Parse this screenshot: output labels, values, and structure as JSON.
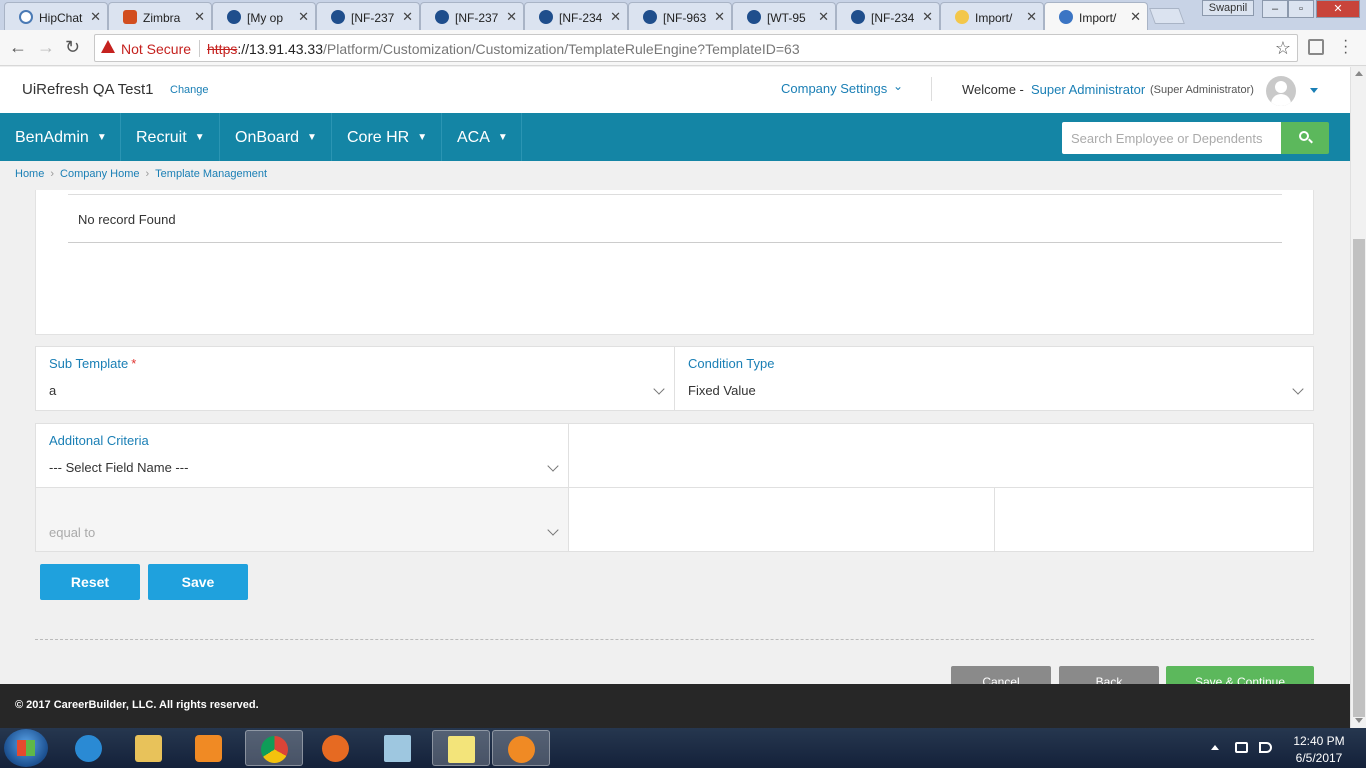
{
  "browser": {
    "tabs": [
      {
        "title": "HipChat",
        "icon": "hipchat-icon"
      },
      {
        "title": "Zimbra",
        "icon": "zimbra-icon"
      },
      {
        "title": "[My op",
        "icon": "jira-icon"
      },
      {
        "title": "[NF-237",
        "icon": "jira-icon"
      },
      {
        "title": "[NF-237",
        "icon": "jira-icon"
      },
      {
        "title": "[NF-234",
        "icon": "jira-icon"
      },
      {
        "title": "[NF-963",
        "icon": "jira-icon"
      },
      {
        "title": "[WT-95",
        "icon": "jira-icon"
      },
      {
        "title": "[NF-234",
        "icon": "jira-icon"
      },
      {
        "title": "Import/",
        "icon": "import-icon"
      },
      {
        "title": "Import/",
        "icon": "import-icon"
      }
    ],
    "window_user": "Swapnil",
    "not_secure": "Not Secure",
    "url_scheme": "https",
    "url_host": "://13.91.43.33",
    "url_path": "/Platform/Customization/Customization/TemplateRuleEngine?TemplateID=63"
  },
  "header": {
    "company_name": "UiRefresh QA Test1",
    "change_link": "Change",
    "company_settings": "Company Settings",
    "welcome": "Welcome -",
    "user_name": "Super Administrator",
    "user_role": "(Super Administrator)"
  },
  "nav": {
    "items": [
      "BenAdmin",
      "Recruit",
      "OnBoard",
      "Core HR",
      "ACA"
    ],
    "search_placeholder": "Search Employee or Dependents"
  },
  "breadcrumb": [
    "Home",
    "Company Home",
    "Template Management"
  ],
  "records": {
    "empty_text": "No record Found"
  },
  "form": {
    "sub_template_label": "Sub Template",
    "sub_template_required": "*",
    "sub_template_value": "a",
    "condition_type_label": "Condition Type",
    "condition_type_value": "Fixed Value",
    "additional_criteria_label": "Additonal Criteria",
    "field_name_placeholder": "--- Select Field Name ---",
    "operator_value": "equal to"
  },
  "buttons": {
    "reset": "Reset",
    "save": "Save",
    "cancel": "Cancel",
    "back": "Back",
    "save_continue": "Save & Continue"
  },
  "footer": {
    "copyright": "© 2017 CareerBuilder, LLC. All rights reserved."
  },
  "taskbar": {
    "time": "12:40 PM",
    "date": "6/5/2017",
    "apps": [
      "internet-explorer-icon",
      "file-explorer-icon",
      "media-player-icon",
      "chrome-icon",
      "firefox-icon",
      "notepad-icon",
      "sticky-notes-icon",
      "app-icon"
    ]
  },
  "colors": {
    "nav_bg": "#1485a5",
    "link": "#1a7fb5",
    "primary_button": "#1fa1dd",
    "success": "#5cb85c",
    "footer_bg": "#272727"
  }
}
